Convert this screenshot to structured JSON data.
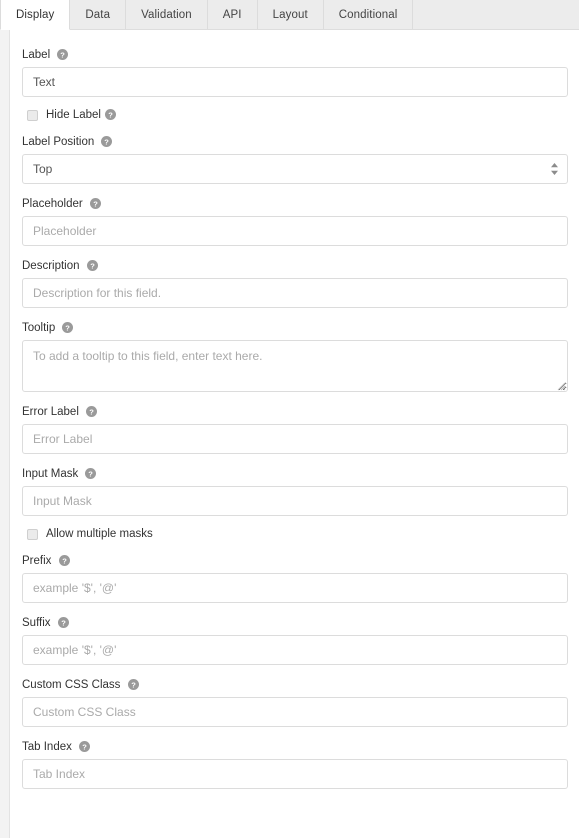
{
  "tabs": [
    {
      "id": "display",
      "label": "Display",
      "active": true
    },
    {
      "id": "data",
      "label": "Data",
      "active": false
    },
    {
      "id": "validation",
      "label": "Validation",
      "active": false
    },
    {
      "id": "api",
      "label": "API",
      "active": false
    },
    {
      "id": "layout",
      "label": "Layout",
      "active": false
    },
    {
      "id": "conditional",
      "label": "Conditional",
      "active": false
    }
  ],
  "icons": {
    "help": "question-circle-icon",
    "select_stepper": "stepper-up-down-icon",
    "resize_grip": "resize-handle-icon"
  },
  "colors": {
    "tabbar_bg": "#ececec",
    "active_tab_bg": "#ffffff",
    "border": "#dcdcdc",
    "label_text": "#333333",
    "input_text": "#555555",
    "placeholder_text": "#aaaaaa",
    "help_icon": "#9a9a9a",
    "checkbox_bg": "#ebebeb"
  },
  "fields": {
    "label": {
      "label": "Label",
      "has_help": true,
      "value": "Text",
      "placeholder": ""
    },
    "hide_label": {
      "label": "Hide Label",
      "has_help": true,
      "checked": false
    },
    "label_position": {
      "label": "Label Position",
      "has_help": true,
      "value": "Top",
      "options": [
        "Top"
      ]
    },
    "placeholder": {
      "label": "Placeholder",
      "has_help": true,
      "value": "",
      "placeholder": "Placeholder"
    },
    "description": {
      "label": "Description",
      "has_help": true,
      "value": "",
      "placeholder": "Description for this field."
    },
    "tooltip": {
      "label": "Tooltip",
      "has_help": true,
      "value": "",
      "placeholder": "To add a tooltip to this field, enter text here."
    },
    "error_label": {
      "label": "Error Label",
      "has_help": true,
      "value": "",
      "placeholder": "Error Label"
    },
    "input_mask": {
      "label": "Input Mask",
      "has_help": true,
      "value": "",
      "placeholder": "Input Mask"
    },
    "allow_multiple_masks": {
      "label": "Allow multiple masks",
      "has_help": false,
      "checked": false
    },
    "prefix": {
      "label": "Prefix",
      "has_help": true,
      "value": "",
      "placeholder": "example '$', '@'"
    },
    "suffix": {
      "label": "Suffix",
      "has_help": true,
      "value": "",
      "placeholder": "example '$', '@'"
    },
    "custom_css_class": {
      "label": "Custom CSS Class",
      "has_help": true,
      "value": "",
      "placeholder": "Custom CSS Class"
    },
    "tab_index": {
      "label": "Tab Index",
      "has_help": true,
      "value": "",
      "placeholder": "Tab Index"
    }
  }
}
